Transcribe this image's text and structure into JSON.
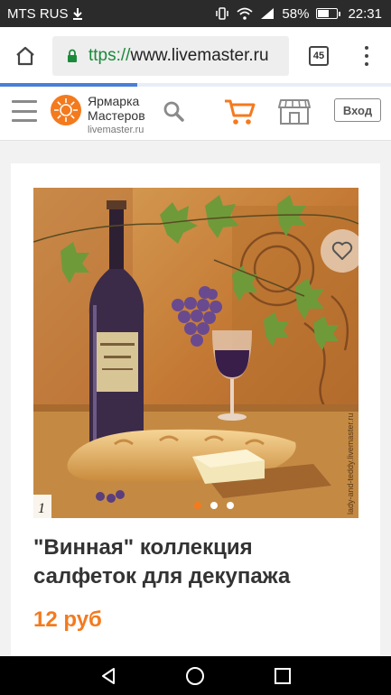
{
  "status_bar": {
    "carrier": "MTS RUS",
    "battery": "58%",
    "time": "22:31"
  },
  "browser": {
    "url_scheme": "ttps://",
    "url_host": "www.livemaster.ru",
    "tabs_count": "45",
    "load_progress": 0.35
  },
  "site_header": {
    "logo_line1": "Ярмарка",
    "logo_line2": "Мастеров",
    "logo_domain": "livemaster.ru",
    "login_label": "Вход"
  },
  "product": {
    "title": "\"Винная\" коллекция салфеток для декупажа",
    "price": "12 руб",
    "image_index": "1",
    "image_watermark": "lady-and-teddy.livemaster.ru",
    "slides_total": 3,
    "slide_active": 1
  },
  "colors": {
    "accent": "#f47a1e",
    "url_green": "#1a8a3a",
    "progress_blue": "#4a7fd8"
  }
}
